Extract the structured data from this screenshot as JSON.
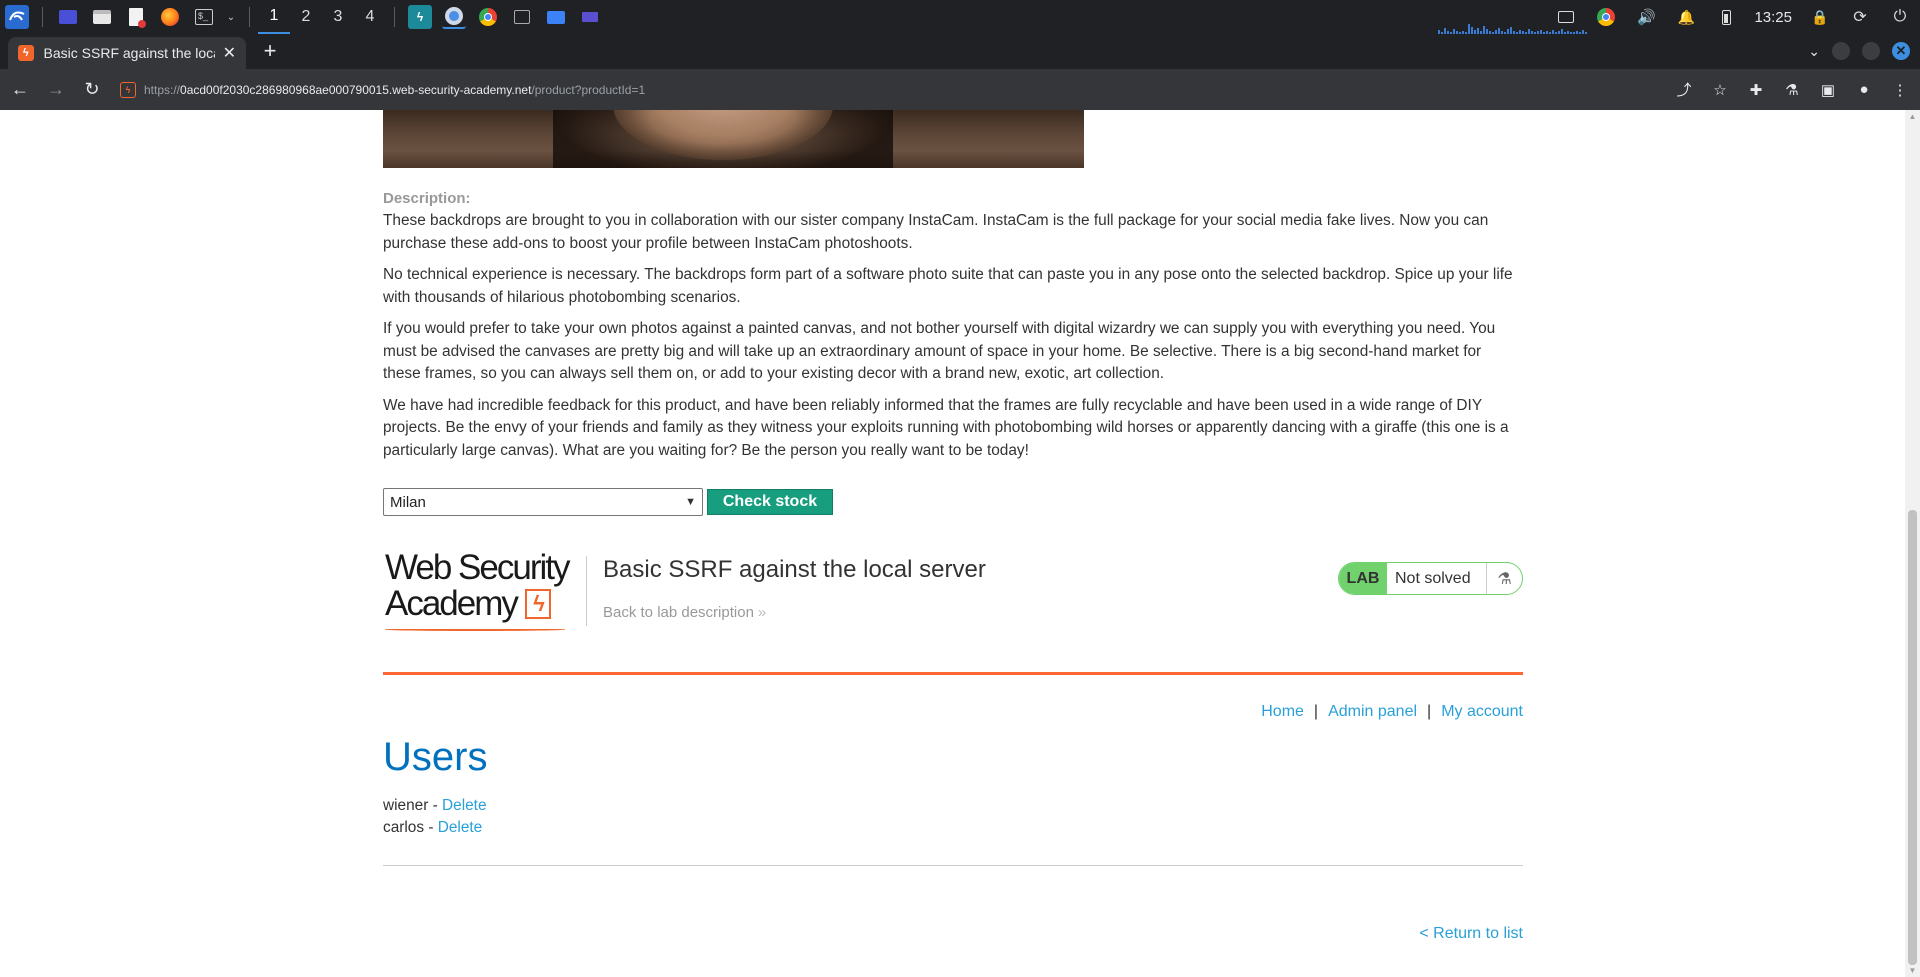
{
  "taskbar": {
    "workspaces": [
      "1",
      "2",
      "3",
      "4"
    ],
    "clock": "13:25"
  },
  "browser": {
    "tab_title": "Basic SSRF against the loca",
    "url_scheme": "https://",
    "url_host": "0acd00f2030c286980968ae000790015.web-security-academy.net",
    "url_path": "/product?productId=1"
  },
  "product": {
    "description_label": "Description:",
    "paragraphs": [
      "These backdrops are brought to you in collaboration with our sister company InstaCam. InstaCam is the full package for your social media fake lives. Now you can purchase these add-ons to boost your profile between InstaCam photoshoots.",
      "No technical experience is necessary. The backdrops form part of a software photo suite that can paste you in any pose onto the selected backdrop. Spice up your life with thousands of hilarious photobombing scenarios.",
      "If you would prefer to take your own photos against a painted canvas, and not bother yourself with digital wizardry we can supply you with everything you need. You must be advised the canvases are pretty big and will take up an extraordinary amount of space in your home. Be selective. There is a big second-hand market for these frames, so you can always sell them on, or add to your existing decor with a brand new, exotic, art collection.",
      "We have had incredible feedback for this product, and have been reliably informed that the frames are fully recyclable and have been used in a wide range of DIY projects. Be the envy of your friends and family as they witness your exploits running with photobombing wild horses or apparently dancing with a giraffe (this one is a particularly large canvas). What are you waiting for? Be the person you really want to be today!"
    ],
    "stock_select_value": "Milan",
    "check_stock_label": "Check stock"
  },
  "lab": {
    "logo_line1": "Web Security",
    "logo_line2": "Academy",
    "title": "Basic SSRF against the local server",
    "back_link": "Back to lab description",
    "badge": "LAB",
    "status": "Not solved"
  },
  "admin": {
    "nav": [
      "Home",
      "Admin panel",
      "My account"
    ],
    "nav_sep": "|",
    "heading": "Users",
    "users": [
      {
        "name": "wiener -",
        "action": "Delete"
      },
      {
        "name": "carlos -",
        "action": "Delete"
      }
    ],
    "return_link": "< Return to list"
  },
  "colors": {
    "accent_orange": "#ff6633",
    "lab_green": "#70d16d",
    "button_green": "#179e7f",
    "link_blue": "#29a0d8",
    "heading_blue": "#0071bc"
  }
}
